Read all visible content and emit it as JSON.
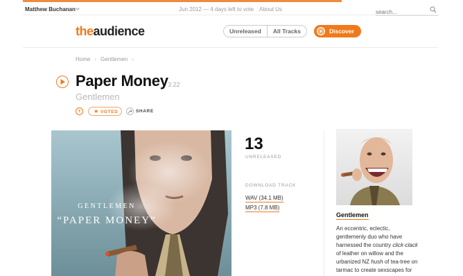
{
  "user_bar": {
    "user_name": "Matthew Buchanan",
    "vote_info": "Jun 2012 — 4 days left to vote",
    "about_link": "About Us",
    "search_placeholder": "search..."
  },
  "header": {
    "logo_prefix": "the",
    "logo_suffix": "audience",
    "nav_tabs": [
      {
        "label": "Unreleased"
      },
      {
        "label": "All Tracks"
      }
    ],
    "discover_label": "Discover"
  },
  "breadcrumb": [
    "Home",
    "Gentlemen"
  ],
  "track": {
    "title": "Paper Money",
    "duration": "3:22",
    "artist": "Gentlemen",
    "voted_label": "VOTED",
    "share_label": "SHARE"
  },
  "album_art": {
    "band_text": "GENTLEMEN",
    "title_text": "“PAPER MONEY”"
  },
  "stats": {
    "vote_count": "13",
    "status": "UNRELEASED",
    "download_heading": "DOWNLOAD TRACK",
    "downloads": [
      {
        "label": "WAV (34.1 MB)"
      },
      {
        "label": "MP3 (7.8 MB)"
      }
    ]
  },
  "artist_panel": {
    "name": "Gentlemen",
    "bio_part1": "An eccentric, eclectic, gentlemenly duo who have harnessed the country ",
    "bio_em1": "click-clack",
    "bio_part2": " of leather on willow and the urbanized NZ ",
    "bio_em2": "hush",
    "bio_part3": " of tea-tree on tarmac to create sexscapes for your soundcards. So slip into a"
  },
  "colors": {
    "accent": "#f07a1a",
    "muted_text": "#999999"
  }
}
